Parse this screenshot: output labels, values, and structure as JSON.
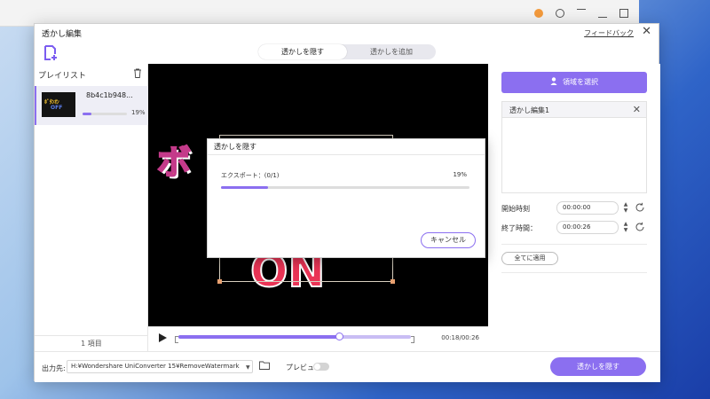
{
  "window": {
    "title": "透かし編集",
    "feedback_link": "フィードバック",
    "close_glyph": "✕"
  },
  "tabs": [
    {
      "label": "透かしを隠す",
      "active": true
    },
    {
      "label": "透かしを追加",
      "active": false
    }
  ],
  "playlist": {
    "heading": "プレイリスト",
    "items": [
      {
        "name": "8b4c1b948...",
        "progress_percent": 19,
        "progress_label": "19%",
        "thumb_line1": "ﾎﾞﾀﾝｵﾝ",
        "thumb_line2": "OFF"
      }
    ],
    "count_label": "1 項目"
  },
  "video": {
    "overlay_text_top": "ボ",
    "overlay_text_bottom": "ON"
  },
  "timeline": {
    "time": "00:18/00:26",
    "progress_fraction": 0.69
  },
  "right_panel": {
    "select_area_label": "領域を選択",
    "watermark_item_label": "透かし編集1",
    "start_time_label": "開始時刻",
    "start_time_value": "00:00:00",
    "end_time_label": "終了時間：",
    "end_time_value": "00:00:26",
    "apply_all_label": "全てに適用"
  },
  "bottom_bar": {
    "output_label": "出力先:",
    "output_path": "H:¥Wondershare UniConverter 15¥RemoveWatermark",
    "preview_label": "プレビュー",
    "preview_on": false,
    "remove_button_label": "透かしを隠す"
  },
  "dialog": {
    "title": "透かしを隠す",
    "export_label": "エクスポート：(0/1)",
    "percent_label": "19%",
    "progress_percent": 19,
    "cancel_label": "キャンセル"
  },
  "colors": {
    "accent": "#8b6ff0",
    "video_bg": "#000000"
  }
}
